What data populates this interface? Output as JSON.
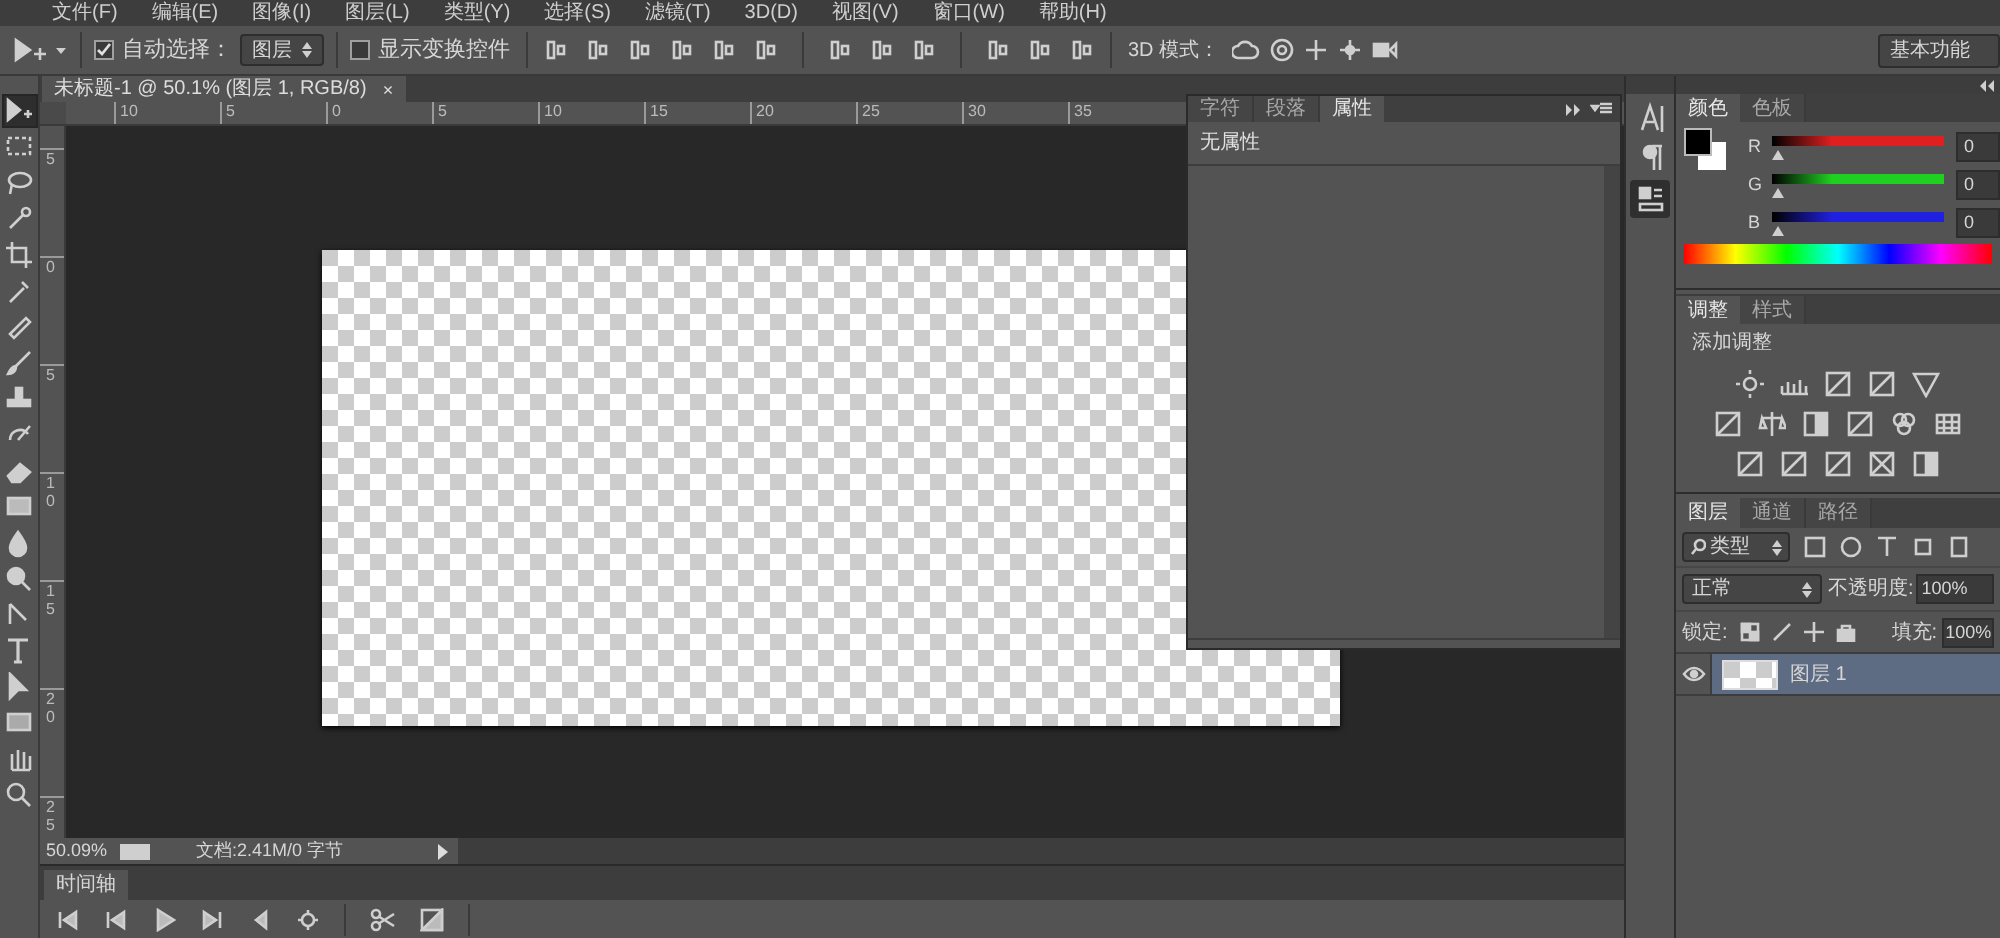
{
  "menu_bar": [
    "文件(F)",
    "编辑(E)",
    "图像(I)",
    "图层(L)",
    "类型(Y)",
    "选择(S)",
    "滤镜(T)",
    "3D(D)",
    "视图(V)",
    "窗口(W)",
    "帮助(H)"
  ],
  "options_bar": {
    "auto_select": {
      "label": "自动选择：",
      "checked": true
    },
    "auto_select_target": "图层",
    "transform_controls": {
      "label": "显示变换控件",
      "checked": false
    },
    "mode_3d_label": "3D 模式：",
    "workspace": "基本功能"
  },
  "tools": [
    {
      "selected": true
    },
    {
      "selected": false
    },
    {
      "selected": false
    },
    {
      "selected": false
    },
    {
      "selected": false
    },
    {
      "selected": false
    },
    {
      "selected": false
    },
    {
      "selected": false
    },
    {
      "selected": false
    },
    {
      "selected": false
    },
    {
      "selected": false
    },
    {
      "selected": false
    },
    {
      "selected": false
    },
    {
      "selected": false
    },
    {
      "selected": false
    },
    {
      "selected": false
    },
    {
      "selected": false
    },
    {
      "selected": false
    },
    {
      "selected": false
    },
    {
      "selected": false
    }
  ],
  "document": {
    "tab_title": "未标题-1 @ 50.1% (图层 1, RGB/8)",
    "close": "×",
    "ruler_h": [
      "10",
      "5",
      "0",
      "5",
      "10",
      "15",
      "20",
      "25",
      "30",
      "35"
    ],
    "ruler_v": [
      "5",
      "0",
      "5",
      "10",
      "15",
      "20",
      "25"
    ],
    "zoom": "50.09%",
    "doc_info": "文档:2.41M/0 字节"
  },
  "properties_panel": {
    "tabs": [
      {
        "label": "字符",
        "selected": false
      },
      {
        "label": "段落",
        "selected": false
      },
      {
        "label": "属性",
        "selected": true
      }
    ],
    "content": "无属性"
  },
  "color_panel": {
    "tabs": [
      {
        "label": "颜色",
        "selected": true
      },
      {
        "label": "色板",
        "selected": false
      }
    ],
    "channels": [
      {
        "label": "R",
        "value": "0",
        "level": 0,
        "color": "#e02020"
      },
      {
        "label": "G",
        "value": "0",
        "level": 0,
        "color": "#20d020"
      },
      {
        "label": "B",
        "value": "0",
        "level": 0,
        "color": "#2020e0"
      }
    ]
  },
  "adjustments_panel": {
    "tabs": [
      {
        "label": "调整",
        "selected": true
      },
      {
        "label": "样式",
        "selected": false
      }
    ],
    "title": "添加调整"
  },
  "layers_panel": {
    "tabs": [
      {
        "label": "图层",
        "selected": true
      },
      {
        "label": "通道",
        "selected": false
      },
      {
        "label": "路径",
        "selected": false
      }
    ],
    "filter": "类型",
    "blend_mode": "正常",
    "opacity_label": "不透明度:",
    "opacity": "100%",
    "lock_label": "锁定:",
    "fill_label": "填充:",
    "fill": "100%",
    "layers": [
      {
        "name": "图层 1",
        "visible": true,
        "selected": true
      }
    ]
  },
  "timeline": {
    "tab": "时间轴"
  }
}
